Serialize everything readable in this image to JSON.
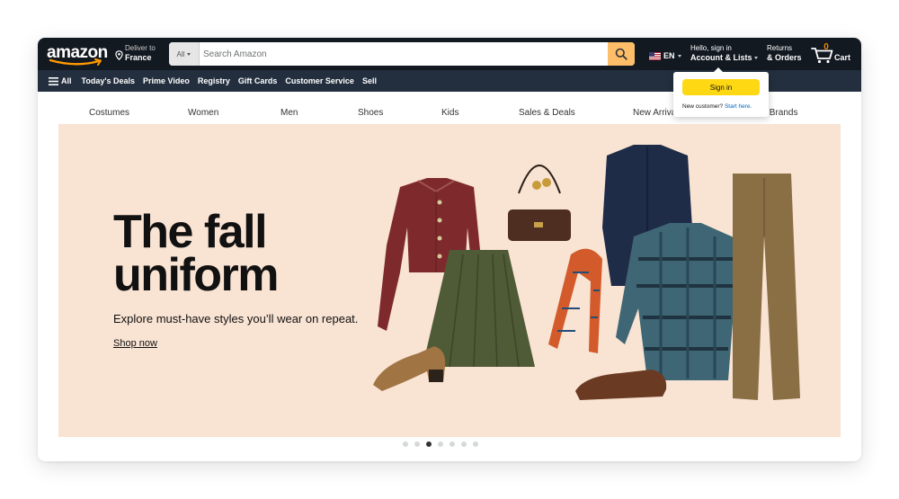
{
  "header": {
    "logo_text": "amazon",
    "deliver_line1": "Deliver to",
    "deliver_line2": "France",
    "search_category": "All",
    "search_placeholder": "Search Amazon",
    "lang_code": "EN",
    "account_line1": "Hello, sign in",
    "account_line2": "Account & Lists",
    "returns_line1": "Returns",
    "returns_line2": "& Orders",
    "cart_count": "0",
    "cart_label": "Cart"
  },
  "subnav": {
    "all_label": "All",
    "items": [
      "Today's Deals",
      "Prime Video",
      "Registry",
      "Gift Cards",
      "Customer Service",
      "Sell"
    ]
  },
  "categories": [
    "Costumes",
    "Women",
    "Men",
    "Shoes",
    "Kids",
    "Sales & Deals",
    "New Arrivals",
    "Premium Brands"
  ],
  "hero": {
    "headline_line1": "The fall",
    "headline_line2": "uniform",
    "subtitle": "Explore must-have styles you’ll wear on repeat.",
    "cta": "Shop now"
  },
  "carousel": {
    "count": 7,
    "active_index": 2
  },
  "flyout": {
    "signin_button": "Sign in",
    "new_customer": "New customer?",
    "start_here": "Start here."
  },
  "colors": {
    "nav_dark": "#131921",
    "nav_sub": "#232f3e",
    "search_button": "#febd69",
    "signin_button": "#ffd814",
    "cart_count": "#f08804",
    "hero_bg": "#f9e3d3",
    "link": "#0066c0"
  }
}
